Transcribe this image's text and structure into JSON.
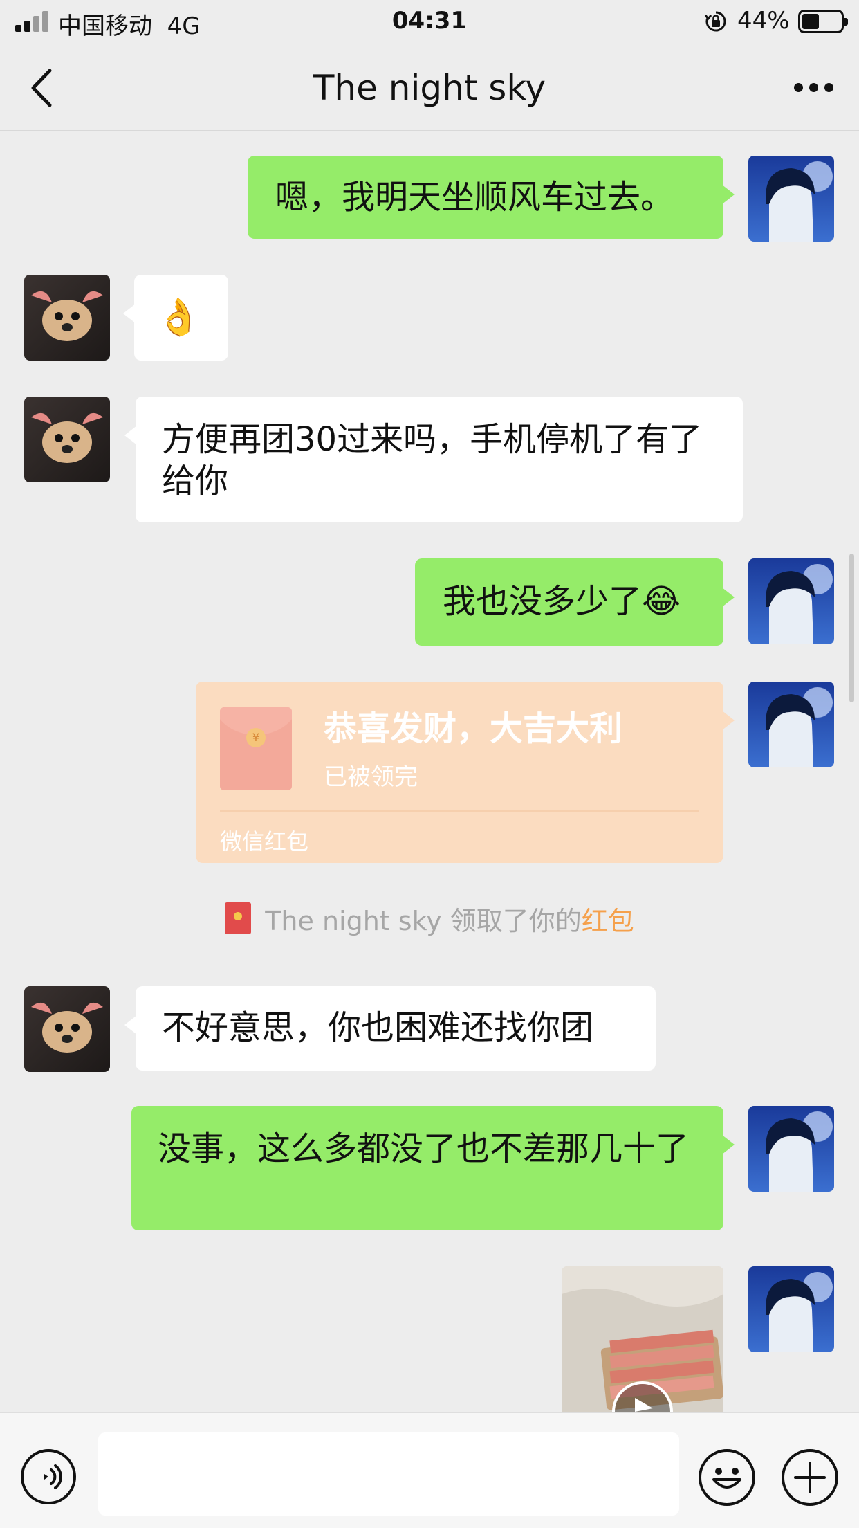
{
  "status_bar": {
    "carrier": "中国移动",
    "network": "4G",
    "time": "04:31",
    "battery_percent": "44%",
    "battery_level": 0.44
  },
  "nav": {
    "title": "The night sky"
  },
  "messages": [
    {
      "from": "me",
      "text": "嗯，我明天坐顺风车过去。"
    },
    {
      "from": "them",
      "text": "👌"
    },
    {
      "from": "them",
      "text": "方便再团30过来吗，手机停机了有了给你"
    },
    {
      "from": "me",
      "text": "我也没多少了😂"
    },
    {
      "from": "me",
      "type": "red_packet",
      "title": "恭喜发财，大吉大利",
      "status": "已被领完",
      "footer": "微信红包"
    },
    {
      "from": "them",
      "text": "不好意思，你也困难还找你团"
    },
    {
      "from": "me",
      "text": "没事，这么多都没了也不差那几十了"
    },
    {
      "from": "me",
      "type": "image"
    }
  ],
  "system_notice": {
    "prefix": "The night sky 领取了你的",
    "highlight": "红包"
  },
  "input_bar": {
    "value": ""
  },
  "colors": {
    "background": "#ededed",
    "bubble_me": "#95ec69",
    "bubble_them": "#ffffff",
    "red_packet": "#fbdcc0",
    "notice_highlight": "#f5a04b"
  },
  "icons": [
    "signal-icon",
    "rotation-lock-icon",
    "battery-icon",
    "back-chevron-icon",
    "more-dots-icon",
    "voice-icon",
    "emoji-icon",
    "plus-icon"
  ]
}
